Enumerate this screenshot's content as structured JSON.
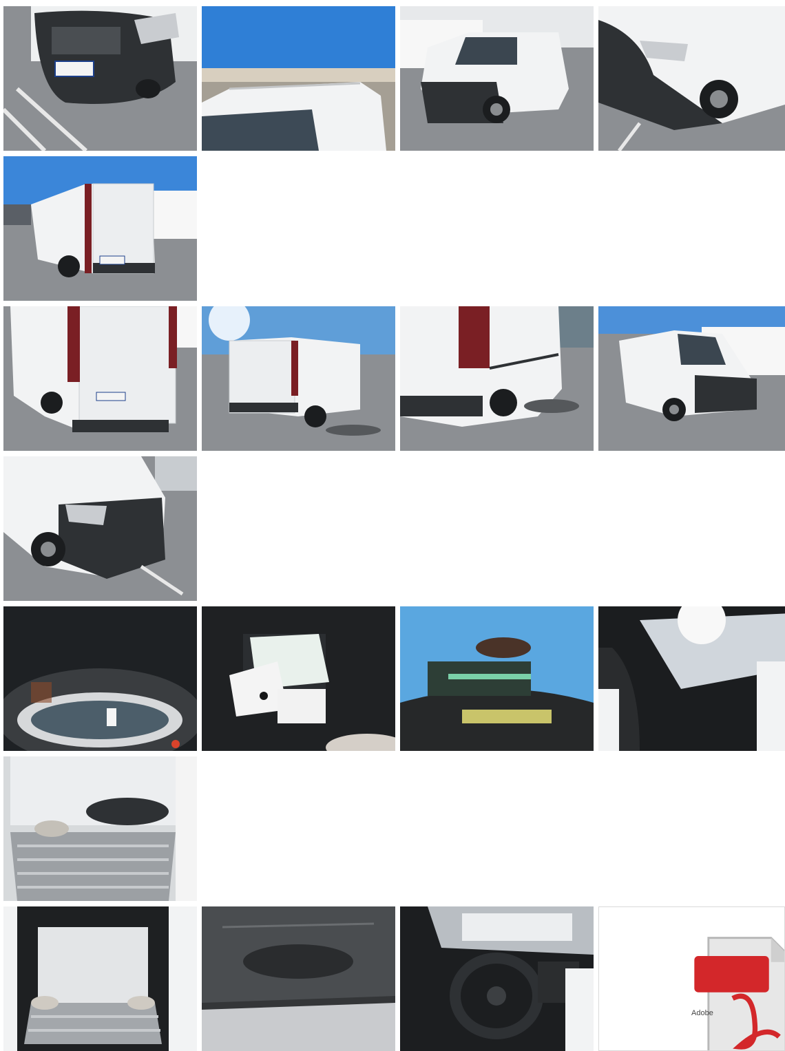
{
  "gallery": {
    "photos": [
      {
        "subject": "front-grille"
      },
      {
        "subject": "roof"
      },
      {
        "subject": "front-three-quarter"
      },
      {
        "subject": "front-right-corner"
      },
      {
        "subject": "rear-left"
      },
      {
        "subject": "rear-doors"
      },
      {
        "subject": "rear-three-quarter"
      },
      {
        "subject": "right-side"
      },
      {
        "subject": "front-right-wide"
      },
      {
        "subject": "front-left-corner"
      },
      {
        "subject": "instrument-cluster"
      },
      {
        "subject": "documents-on-seat"
      },
      {
        "subject": "vin-plate"
      },
      {
        "subject": "cabin-passenger-side"
      },
      {
        "subject": "cargo-area-side"
      },
      {
        "subject": "cargo-area-rear"
      },
      {
        "subject": "cargo-ceiling"
      },
      {
        "subject": "dashboard-steering-wheel"
      }
    ],
    "pdf": {
      "badge": "PDF",
      "brand": "Adobe"
    },
    "colors": {
      "van_white": "#f2f3f4",
      "bumper": "#2e3134",
      "asphalt": "#8c8f93",
      "sky": "#2f7fd6",
      "pdf_red": "#d3272a"
    }
  }
}
